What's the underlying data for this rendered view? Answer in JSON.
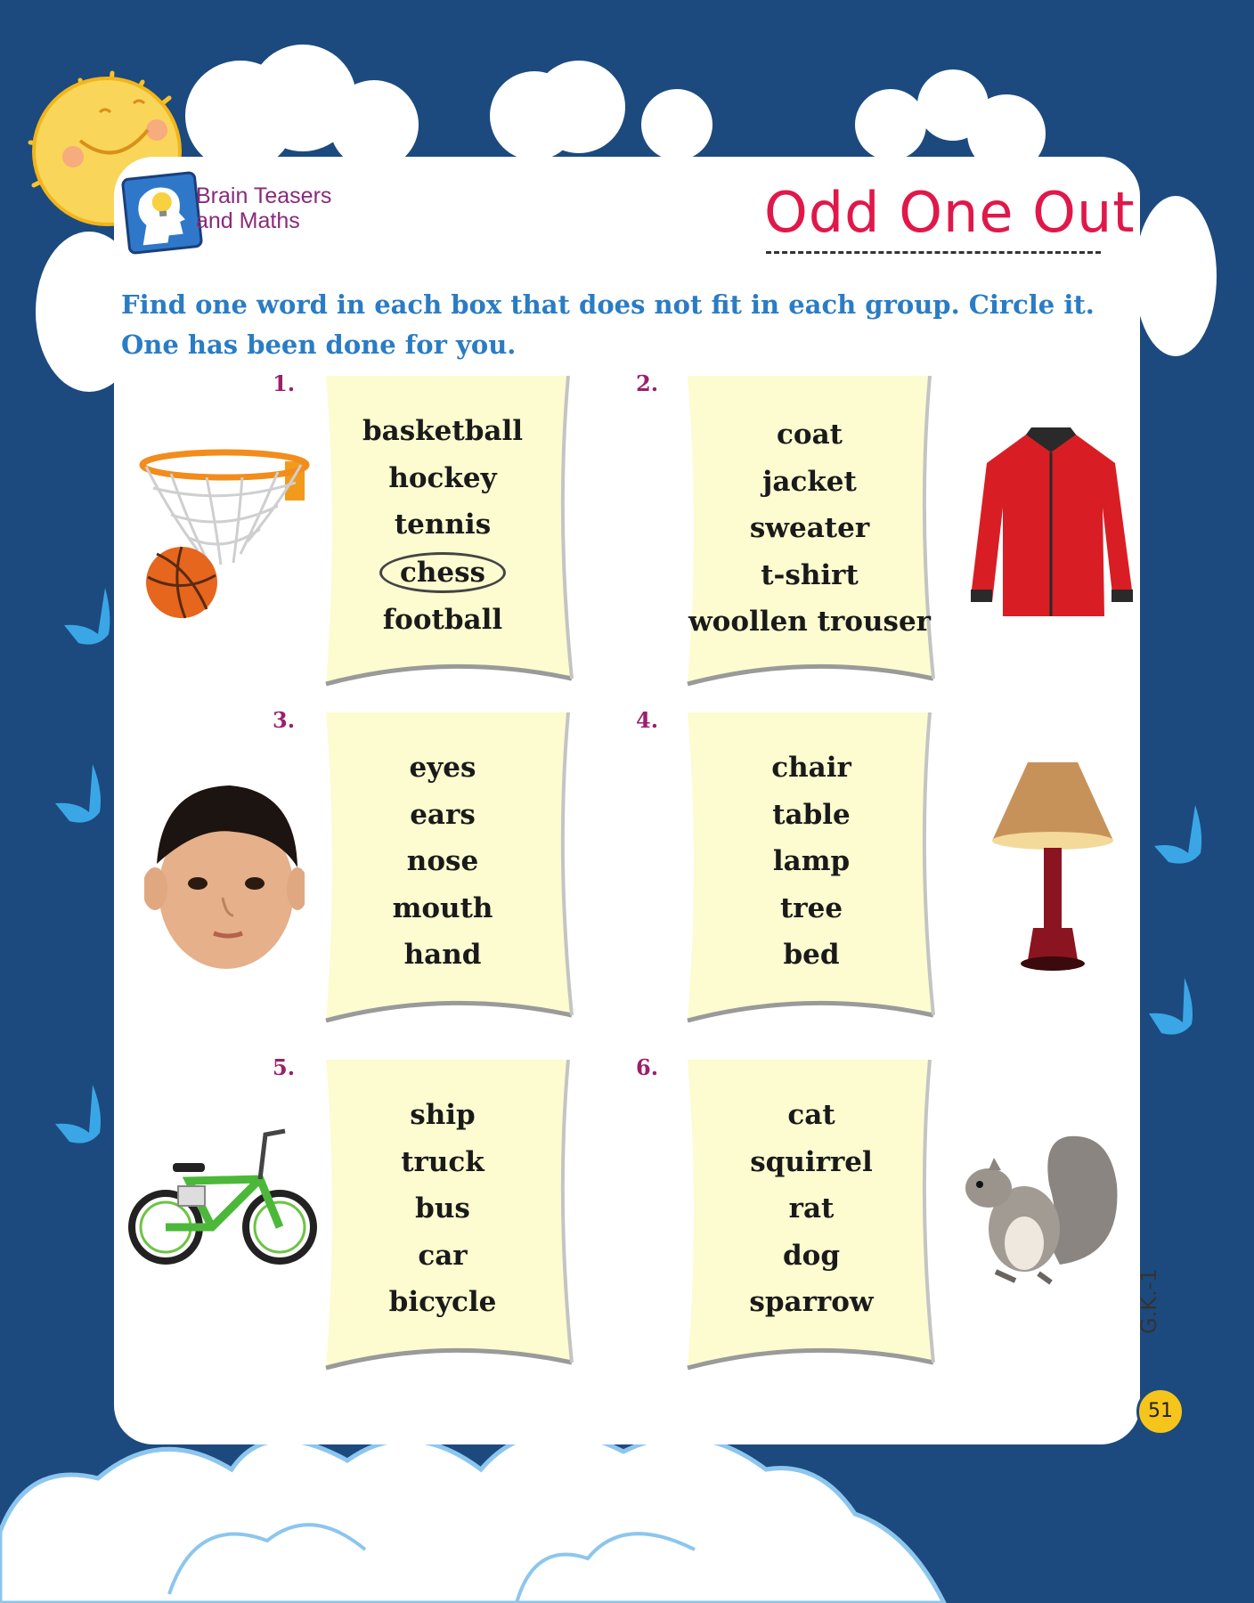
{
  "header": {
    "badge_text": "Brain Teasers and Maths",
    "title": "Odd One Out"
  },
  "instructions": "Find one word in each box that does not fit in each group. Circle it. One has been done for you.",
  "boxes": [
    {
      "number": "1.",
      "words": [
        "basketball",
        "hockey",
        "tennis",
        "chess",
        "football"
      ],
      "circled_index": 3,
      "picture": "basketball-hoop"
    },
    {
      "number": "2.",
      "words": [
        "coat",
        "jacket",
        "sweater",
        "t-shirt",
        "woollen trouser"
      ],
      "circled_index": -1,
      "picture": "red-jacket"
    },
    {
      "number": "3.",
      "words": [
        "eyes",
        "ears",
        "nose",
        "mouth",
        "hand"
      ],
      "circled_index": -1,
      "picture": "child-face"
    },
    {
      "number": "4.",
      "words": [
        "chair",
        "table",
        "lamp",
        "tree",
        "bed"
      ],
      "circled_index": -1,
      "picture": "table-lamp"
    },
    {
      "number": "5.",
      "words": [
        "ship",
        "truck",
        "bus",
        "car",
        "bicycle"
      ],
      "circled_index": -1,
      "picture": "bicycle"
    },
    {
      "number": "6.",
      "words": [
        "cat",
        "squirrel",
        "rat",
        "dog",
        "sparrow"
      ],
      "circled_index": -1,
      "picture": "squirrel"
    }
  ],
  "footer": {
    "series": "G.K.-1",
    "page_number": "51"
  },
  "colors": {
    "background": "#1c4a7e",
    "title": "#e0184a",
    "instructions": "#2a7cc4",
    "number": "#9b1f6a",
    "paper": "#fdfbd0"
  }
}
